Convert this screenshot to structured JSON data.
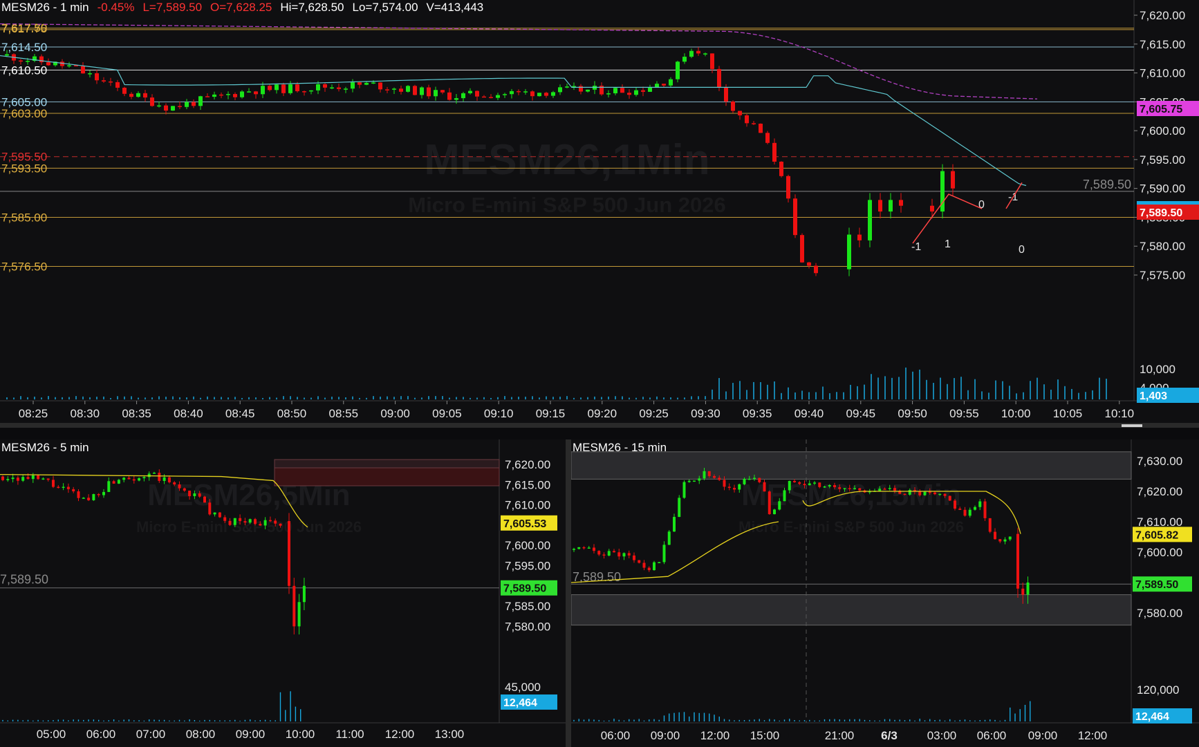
{
  "main": {
    "header": {
      "symbol": "MESM26 - 1 min",
      "change": "-0.45%",
      "last": "L=7,589.50",
      "open": "O=7,628.25",
      "high": "Hi=7,628.50",
      "low": "Lo=7,574.00",
      "volume": "V=413,443"
    },
    "watermark": {
      "title": "MESM26,1Min",
      "subtitle": "Micro E-mini S&P 500 Jun 2026"
    },
    "price_axis": [
      "7,620.00",
      "7,615.00",
      "7,610.00",
      "7,605.00",
      "7,600.00",
      "7,595.00",
      "7,590.00",
      "7,585.00",
      "7,580.00",
      "7,575.00"
    ],
    "volume_axis": [
      "10,000",
      "4,000"
    ],
    "time_axis": [
      "08:25",
      "08:30",
      "08:35",
      "08:40",
      "08:45",
      "08:50",
      "08:55",
      "09:00",
      "09:05",
      "09:10",
      "09:15",
      "09:20",
      "09:25",
      "09:30",
      "09:35",
      "09:40",
      "09:45",
      "09:50",
      "09:55",
      "10:00",
      "10:05",
      "10:10"
    ],
    "levels": [
      {
        "label": "7,617.75",
        "color": "#e0b040"
      },
      {
        "label": "7,617.50",
        "color": "#e0b040"
      },
      {
        "label": "7,614.50",
        "color": "#9fd6ee"
      },
      {
        "label": "7,610.50",
        "color": "#ffffff"
      },
      {
        "label": "7,605.00",
        "color": "#9fd6ee"
      },
      {
        "label": "7,603.00",
        "color": "#e0b040"
      },
      {
        "label": "7,595.50",
        "color": "#e03030"
      },
      {
        "label": "7,593.50",
        "color": "#e0b040"
      },
      {
        "label": "7,585.00",
        "color": "#e0b040"
      },
      {
        "label": "7,576.50",
        "color": "#e0b040"
      }
    ],
    "right_label": "7,589.50",
    "badges": {
      "vwap": "7,605.75",
      "last": "7,589.50",
      "last_hidden": "7,590.00",
      "volume": "1,403"
    },
    "trade_labels": [
      "-1",
      "1",
      "0",
      "-1",
      "0"
    ]
  },
  "pane5": {
    "header": "MESM26 - 5 min",
    "watermark": {
      "title": "MESM26,5Min",
      "subtitle": "Micro E-mini S&P 500 Jun 2026"
    },
    "price_axis": [
      "7,620.00",
      "7,615.00",
      "7,610.00",
      "7,600.00",
      "7,595.00",
      "7,585.00",
      "7,580.00"
    ],
    "volume_axis": [
      "45,000"
    ],
    "time_axis": [
      "05:00",
      "06:00",
      "07:00",
      "08:00",
      "09:00",
      "10:00",
      "11:00",
      "12:00",
      "13:00"
    ],
    "level_label": "7,589.50",
    "badges": {
      "vwap": "7,605.53",
      "last": "7,589.50",
      "volume": "12,464"
    }
  },
  "pane15": {
    "header": "MESM26 - 15 min",
    "watermark": {
      "title": "MESM26,15Min",
      "subtitle": "Micro E-mini S&P 500 Jun 2026"
    },
    "price_axis": [
      "7,630.00",
      "7,620.00",
      "7,610.00",
      "7,600.00",
      "7,580.00"
    ],
    "volume_axis": [
      "120,000"
    ],
    "time_axis": [
      "06:00",
      "09:00",
      "12:00",
      "15:00",
      "21:00",
      "6/3",
      "03:00",
      "06:00",
      "09:00",
      "12:00"
    ],
    "level_label": "7,589.50",
    "badges": {
      "vwap": "7,605.82",
      "last": "7,589.50",
      "volume": "12,464"
    }
  },
  "colors": {
    "up": "#19e619",
    "down": "#ee1111",
    "vwap_line": "#b040c0",
    "ema_line": "#5fc8d0",
    "yellow_line": "#e6d21e",
    "badge_pink": "#e040e0",
    "badge_red": "#e01818",
    "badge_blue": "#18a8e0",
    "badge_yellow": "#f0e020",
    "badge_green": "#30e030"
  }
}
